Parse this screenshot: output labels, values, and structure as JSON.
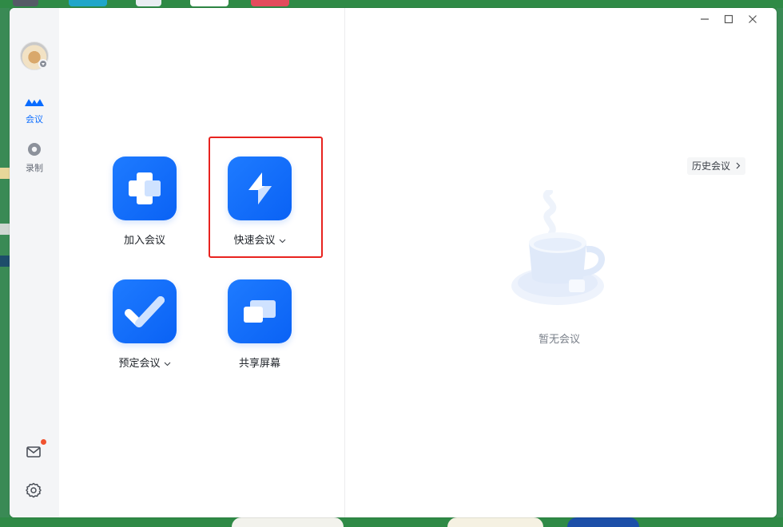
{
  "window": {
    "controls": [
      "minimize-icon",
      "maximize-icon",
      "close-icon"
    ]
  },
  "sidebar": {
    "nav": [
      {
        "label": "会议",
        "icon": "meeting-icon",
        "active": true
      },
      {
        "label": "录制",
        "icon": "record-icon",
        "active": false
      }
    ],
    "bottom_icons": [
      "mail-icon",
      "settings-icon"
    ],
    "has_unread_mail": true,
    "accent": "#0a6cff"
  },
  "actions": [
    {
      "label": "加入会议",
      "icon": "plus-icon",
      "has_dropdown": false
    },
    {
      "label": "快速会议",
      "icon": "lightning-icon",
      "has_dropdown": true,
      "highlighted": true
    },
    {
      "label": "预定会议",
      "icon": "check-icon",
      "has_dropdown": true
    },
    {
      "label": "共享屏幕",
      "icon": "screen-share-icon",
      "has_dropdown": false
    }
  ],
  "right_panel": {
    "history_label": "历史会议",
    "empty_text": "暂无会议",
    "empty_icon": "coffee-cup-icon"
  },
  "colors": {
    "tile_blue": "#1e7bff",
    "highlight_red": "#e8231f",
    "notification": "#f0522f"
  }
}
